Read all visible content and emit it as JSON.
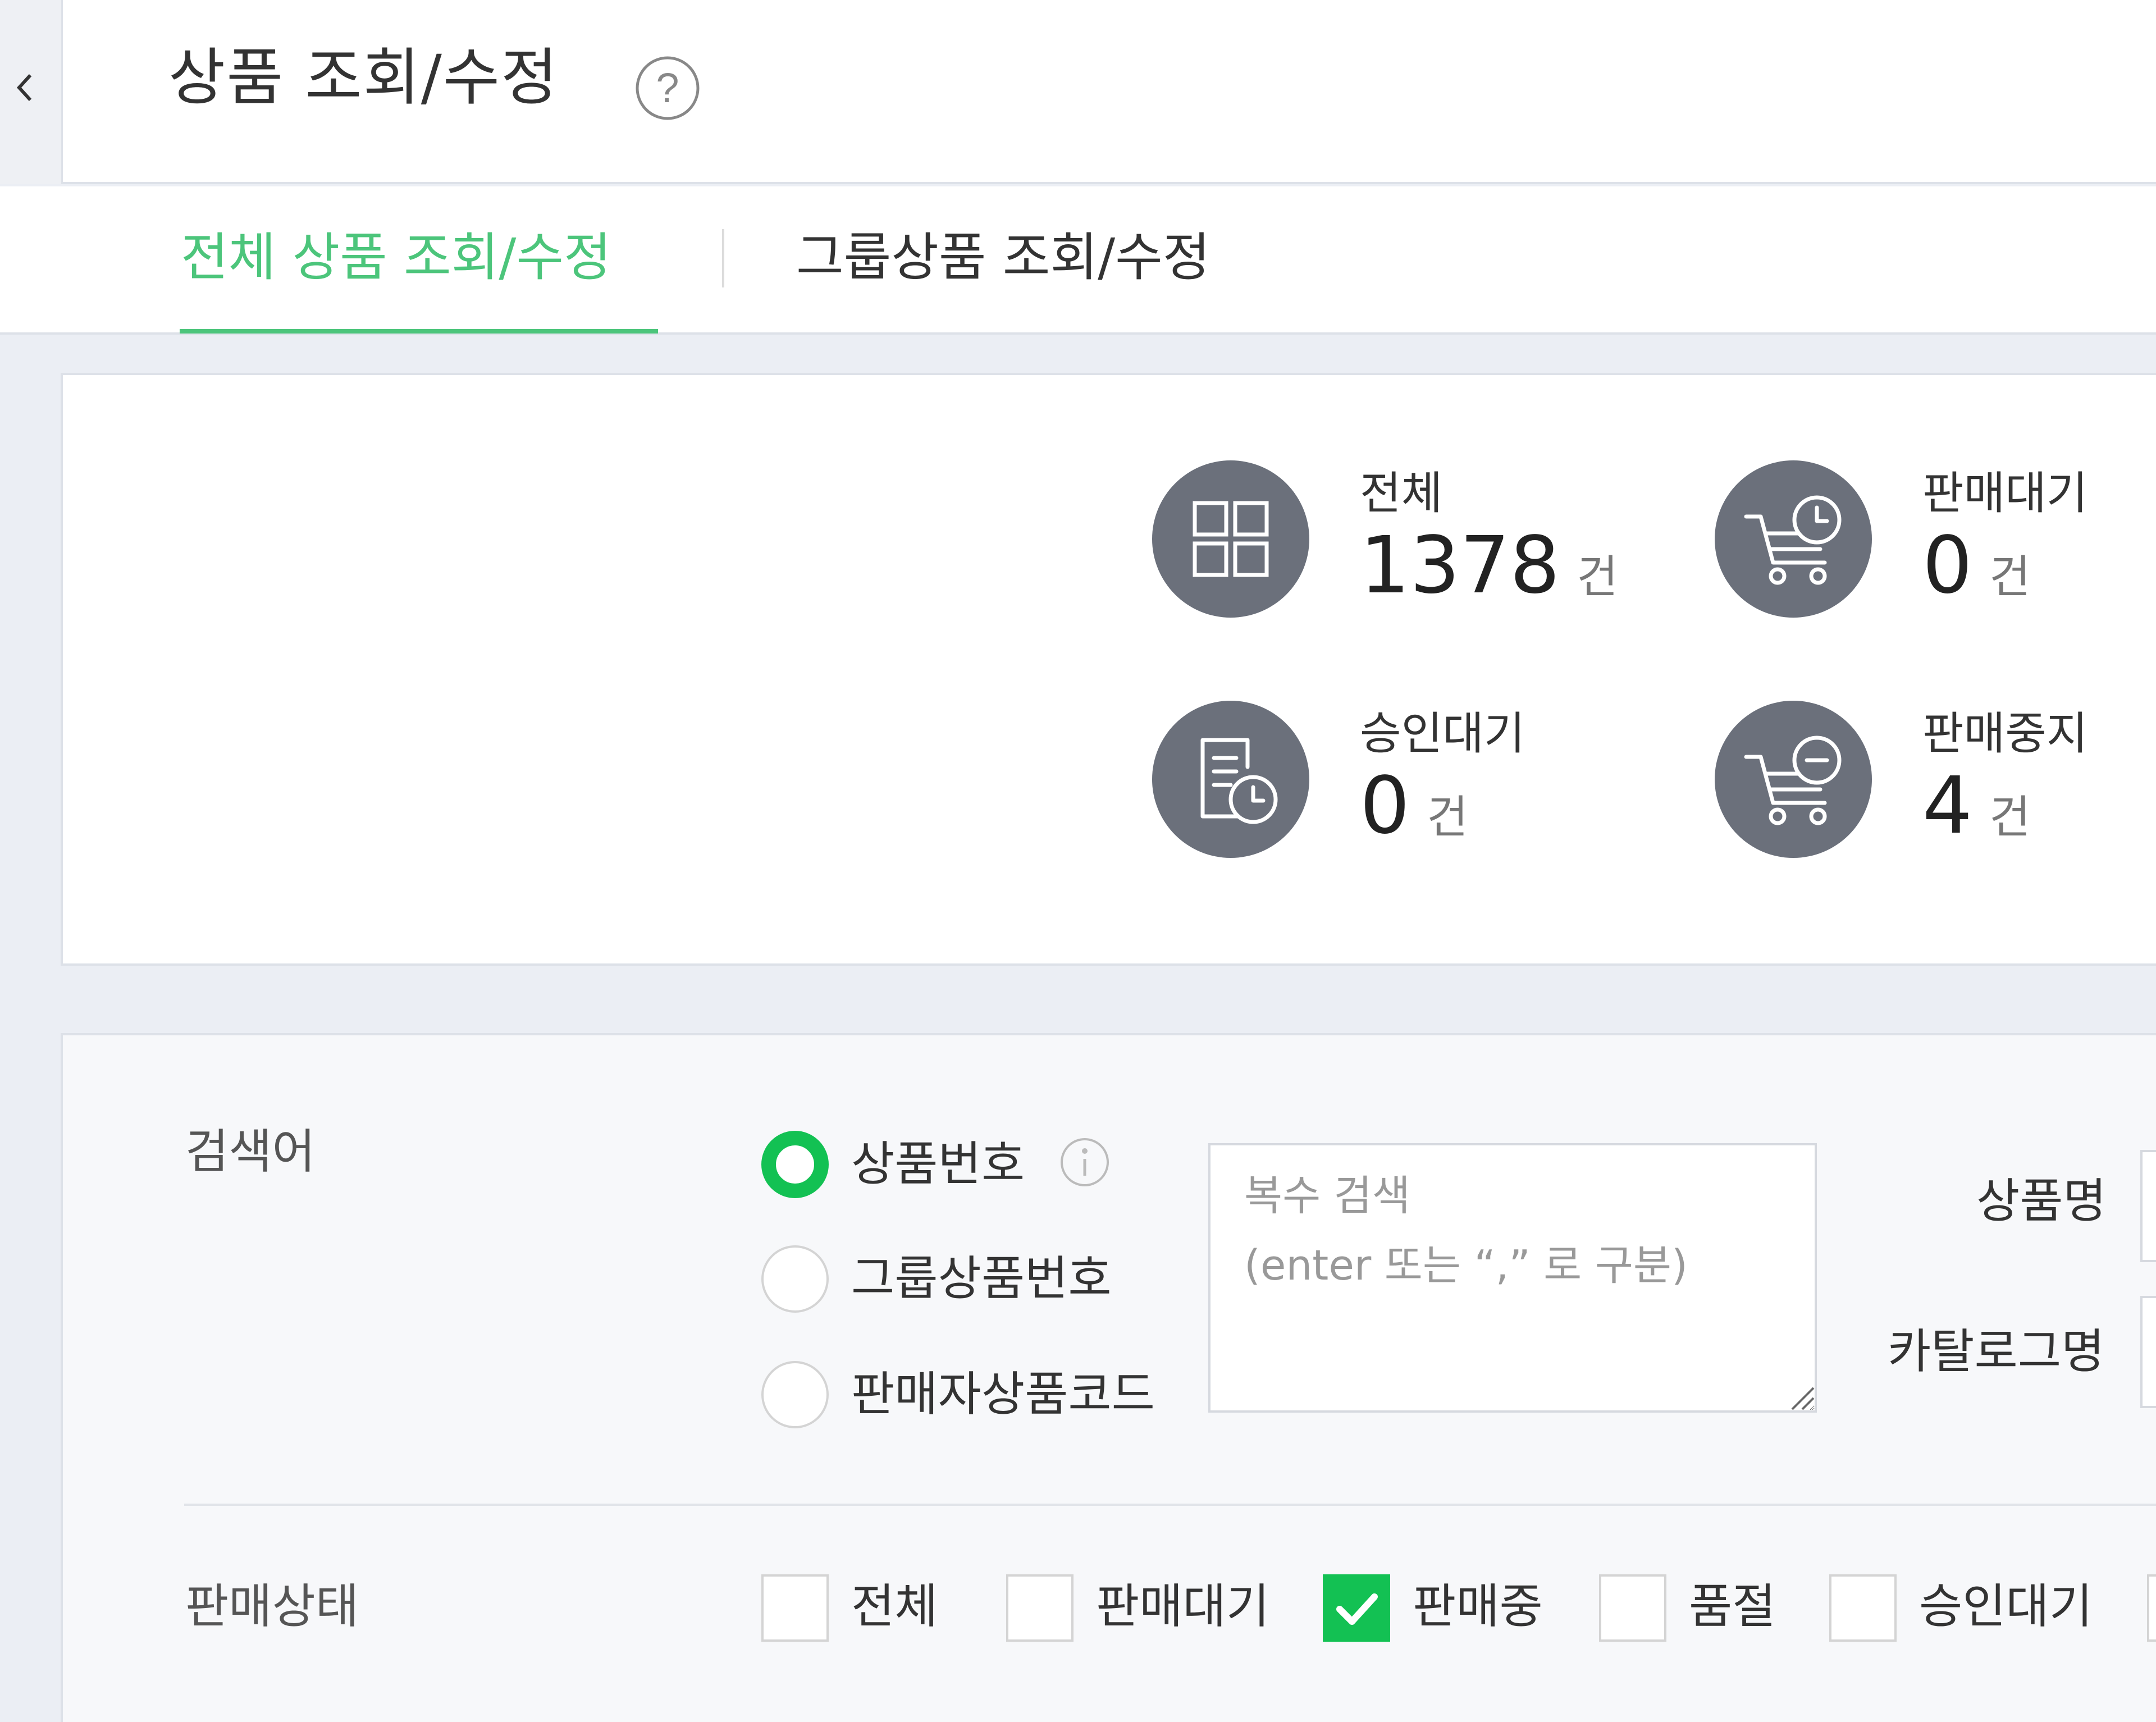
{
  "header": {
    "title": "상품 조회/수정",
    "back_icon": "chevron-left-icon",
    "help_icon": "question-circle-icon"
  },
  "tabs": [
    {
      "label": "전체 상품 조회/수정",
      "active": true
    },
    {
      "label": "그룹상품 조회/수정",
      "active": false
    }
  ],
  "colors": {
    "accent": "#4cc57b",
    "checked": "#13c153",
    "stat_circle": "#6b707b",
    "background": "#ebeef4"
  },
  "summary": {
    "total": {
      "label": "전체",
      "value": "1378",
      "unit": "건",
      "icon": "grid-icon"
    },
    "pending_sale": {
      "label": "판매대기",
      "value": "0",
      "unit": "건",
      "icon": "cart-clock-icon"
    },
    "pending_approval": {
      "label": "승인대기",
      "value": "0",
      "unit": "건",
      "icon": "document-clock-icon"
    },
    "sale_stopped": {
      "label": "판매중지",
      "value": "4",
      "unit": "건",
      "icon": "cart-minus-icon"
    }
  },
  "search": {
    "keyword_label": "검색어",
    "radio_options": [
      {
        "label": "상품번호",
        "checked": true
      },
      {
        "label": "그룹상품번호",
        "checked": false
      },
      {
        "label": "판매자상품코드",
        "checked": false
      }
    ],
    "textarea_placeholder": "복수 검색\n(enter 또는 “,” 로 구분)",
    "product_name_label": "상품명",
    "catalog_name_label": "카탈로그명"
  },
  "sale_status": {
    "label": "판매상태",
    "options": [
      {
        "label": "전체",
        "checked": false
      },
      {
        "label": "판매대기",
        "checked": false
      },
      {
        "label": "판매중",
        "checked": true
      },
      {
        "label": "품절",
        "checked": false
      },
      {
        "label": "승인대기",
        "checked": false
      }
    ]
  }
}
